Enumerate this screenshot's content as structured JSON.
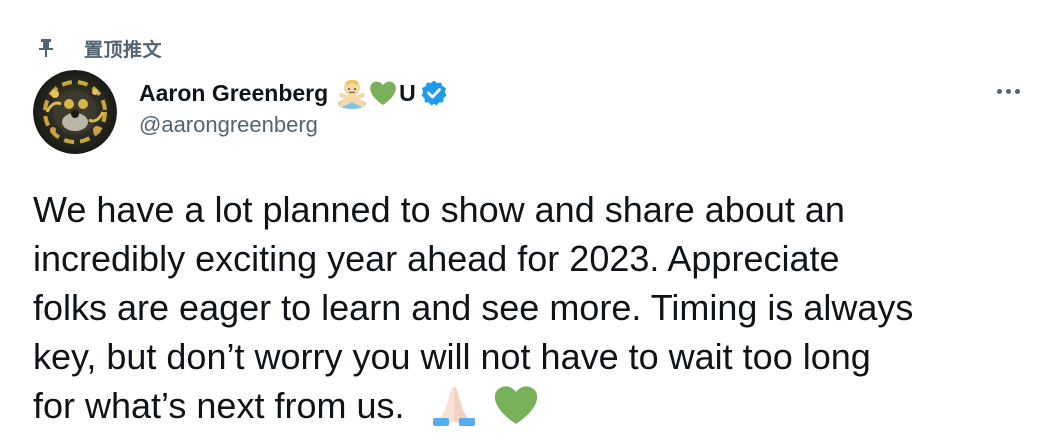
{
  "pinned": {
    "label": "置顶推文",
    "icon": "pin-icon"
  },
  "author": {
    "display_name": "Aaron Greenberg",
    "name_emojis": [
      "person-gesturing-no-emoji",
      "green-heart-emoji"
    ],
    "name_suffix": "U",
    "verified": true,
    "handle": "@aarongreenberg",
    "avatar": "avatar"
  },
  "more_menu": {
    "icon": "more-horizontal-icon"
  },
  "tweet": {
    "lines": [
      "We have a lot planned to show and share about an",
      "incredibly exciting year ahead for 2023. Appreciate",
      "folks are eager to learn and see more. Timing is always",
      "key, but don’t worry you will not have to wait too long",
      "for what’s next from us."
    ],
    "trailing_emojis": [
      "folded-hands-emoji",
      "green-heart-emoji"
    ]
  },
  "colors": {
    "text_primary": "#0f1419",
    "text_secondary": "#536471",
    "verified_blue": "#1d9bf0",
    "heart_green": "#78b159"
  }
}
